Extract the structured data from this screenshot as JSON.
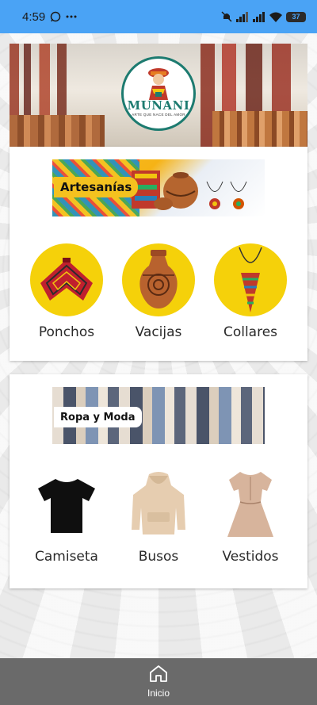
{
  "status": {
    "time": "4:59",
    "battery": "37"
  },
  "hero": {
    "logo_name": "MUNANI",
    "logo_tagline": "ARTE QUE NACE DEL AMOR"
  },
  "artesanias": {
    "banner_label": "Artesanías",
    "categories": [
      {
        "label": "Ponchos",
        "icon": "poncho-icon"
      },
      {
        "label": "Vacijas",
        "icon": "vase-icon"
      },
      {
        "label": "Collares",
        "icon": "necklace-icon"
      }
    ]
  },
  "ropa": {
    "banner_label": "Ropa y Moda",
    "categories": [
      {
        "label": "Camiseta",
        "icon": "tshirt-icon"
      },
      {
        "label": "Busos",
        "icon": "hoodie-icon"
      },
      {
        "label": "Vestidos",
        "icon": "dress-icon"
      }
    ]
  },
  "nav": {
    "home_label": "Inicio"
  },
  "colors": {
    "status_bar": "#4aa3f5",
    "accent_yellow": "#f5d10a",
    "brand_teal": "#1d7b70",
    "nav_bg": "#6a6a6a"
  }
}
